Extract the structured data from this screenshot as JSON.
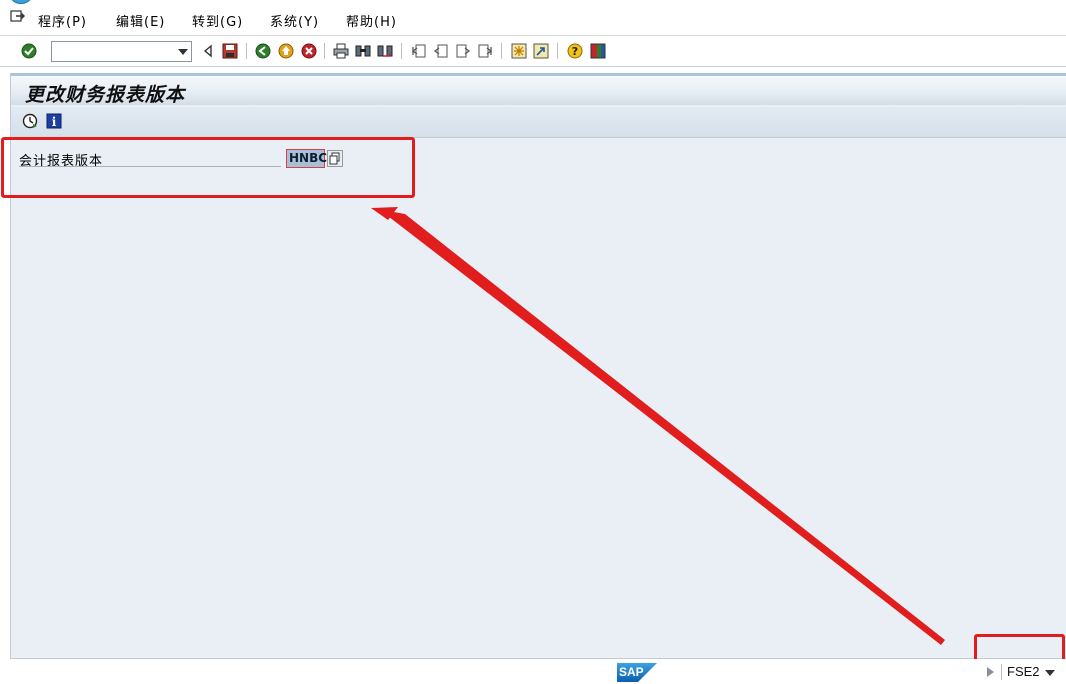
{
  "menu": {
    "items": [
      {
        "label": "程序(P)"
      },
      {
        "label": "编辑(E)"
      },
      {
        "label": "转到(G)"
      },
      {
        "label": "系统(Y)"
      },
      {
        "label": "帮助(H)"
      }
    ]
  },
  "toolbar": {
    "command_field_value": ""
  },
  "window": {
    "title": "更改财务报表版本"
  },
  "form": {
    "field_label": "会计报表版本",
    "field_value": "HNBC"
  },
  "status": {
    "transaction_code": "FSE2",
    "logo_text": "SAP"
  },
  "colors": {
    "annotation": "#e11d1d",
    "background": "#e9eff5",
    "title_accent": "#a9c4dc"
  }
}
